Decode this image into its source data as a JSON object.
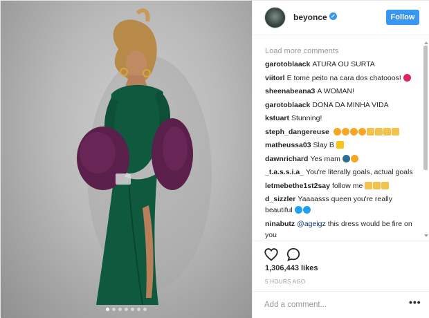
{
  "header": {
    "username": "beyonce",
    "verified_mark": "✓",
    "follow_label": "Follow"
  },
  "comments": {
    "load_more": "Load more comments",
    "items": [
      {
        "user": "garotoblaack",
        "text": "ATURA OU SURTA"
      },
      {
        "user": "viitorl",
        "text": "E tome peito na cara dos chatooos!"
      },
      {
        "user": "sheenabeana3",
        "text": "A WOMAN!"
      },
      {
        "user": "garotoblaack",
        "text": "DONA DA MINHA VIDA"
      },
      {
        "user": "kstuart",
        "text": "Stunning!"
      },
      {
        "user": "steph_dangereuse",
        "text": ""
      },
      {
        "user": "matheussa03",
        "text": "Slay B"
      },
      {
        "user": "dawnrichard",
        "text": "Yes mam"
      },
      {
        "user": "_t.a.s.s.i.a_",
        "text": "You're literally goals, actual goals"
      },
      {
        "user": "letmebethe1st2say",
        "text": "follow me"
      },
      {
        "user": "d_sizzler",
        "text": "Yaaaasss queen you're really beautiful"
      },
      {
        "user": "ninabutz",
        "mention": "@ageigz",
        "text": "this dress would be fire on you"
      }
    ]
  },
  "actions": {
    "likes": "1,306,443 likes",
    "time_ago": "5 HOURS AGO"
  },
  "add_comment": {
    "placeholder": "Add a comment...",
    "more": "•••"
  },
  "icons": [
    "heart-icon",
    "comment-icon",
    "more-options-icon",
    "verified-badge-icon"
  ],
  "colors": {
    "accent": "#3897f0",
    "muted": "#999999",
    "dress": "#0f5a3f",
    "fur": "#5a1f4a"
  },
  "carousel": {
    "count": 7,
    "active": 0
  }
}
